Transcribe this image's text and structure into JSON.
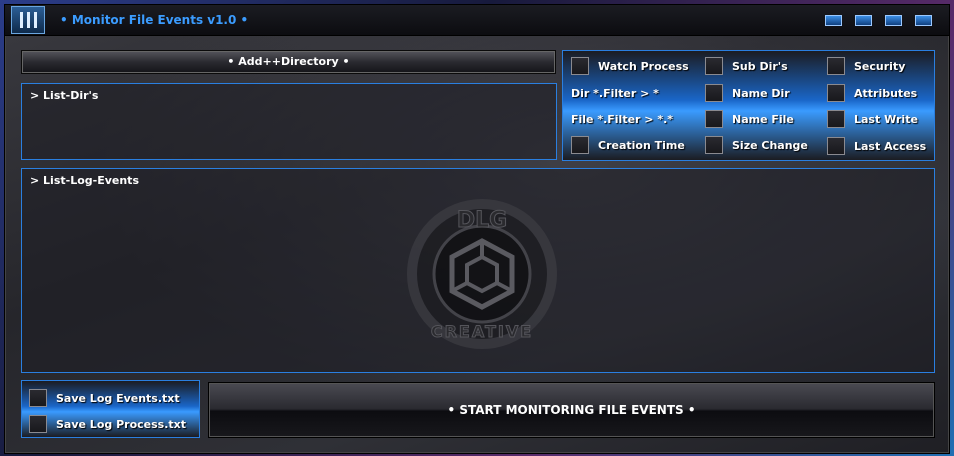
{
  "window": {
    "title": "• Monitor File Events v1.0 •"
  },
  "toolbar": {
    "add_directory_label": "• Add++Directory •"
  },
  "lists": {
    "dirs_label": "> List-Dir's",
    "log_events_label": "> List-Log-Events"
  },
  "options": {
    "watch_process": "Watch Process",
    "sub_dirs": "Sub Dir's",
    "security": "Security",
    "dir_filter": "Dir *.Filter > *",
    "name_dir": "Name Dir",
    "attributes": "Attributes",
    "file_filter": "File *.Filter > *.*",
    "name_file": "Name File",
    "last_write": "Last Write",
    "creation_time": "Creation Time",
    "size_change": "Size Change",
    "last_access": "Last Access"
  },
  "save": {
    "log_events": "Save Log Events.txt",
    "log_process": "Save Log Process.txt"
  },
  "start_label": "• START MONITORING FILE EVENTS •",
  "logo": {
    "top_text": "DLG",
    "bottom_text": "CREATIVE"
  },
  "colors": {
    "accent": "#2a7fe0",
    "title": "#3b9cff"
  }
}
